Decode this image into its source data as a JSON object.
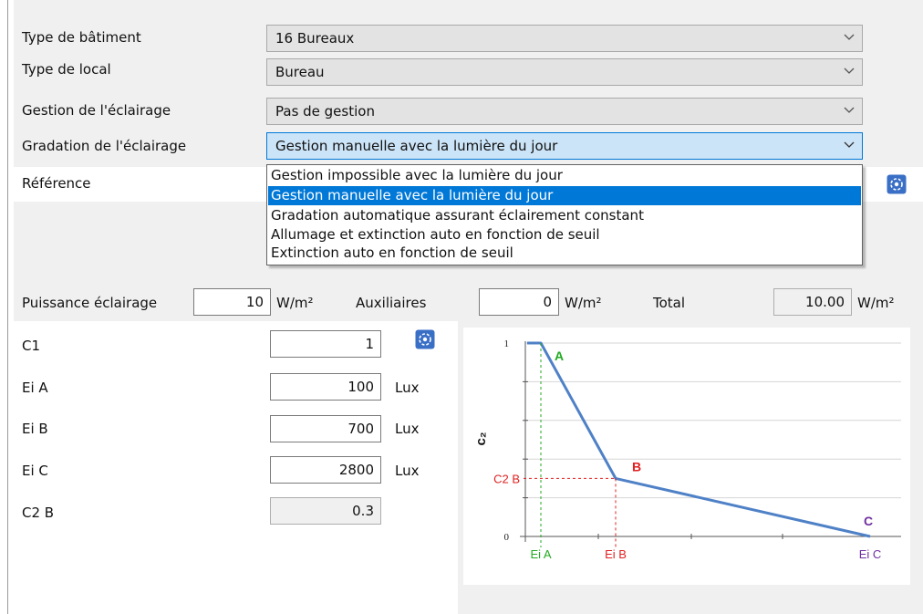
{
  "fields": [
    {
      "label": "Type de bâtiment",
      "value": "16 Bureaux"
    },
    {
      "label": "Type de local",
      "value": "Bureau"
    },
    {
      "label": "Gestion de l'éclairage",
      "value": "Pas de gestion"
    },
    {
      "label": "Gradation de l'éclairage",
      "value": "Gestion manuelle avec la lumière du jour"
    }
  ],
  "reference": {
    "label": "Référence"
  },
  "dropdown_options": [
    "Gestion impossible avec la lumière du jour",
    "Gestion manuelle avec la lumière du jour",
    "Gradation automatique assurant éclairement constant",
    "Allumage et extinction auto en fonction de seuil",
    "Extinction auto en fonction de seuil"
  ],
  "dropdown_selected_index": 1,
  "power": {
    "puissance_label": "Puissance éclairage",
    "puissance_value": "10",
    "puissance_unit": "W/m²",
    "auxiliaires_label": "Auxiliaires",
    "auxiliaires_value": "0",
    "auxiliaires_unit": "W/m²",
    "total_label": "Total",
    "total_value": "10.00",
    "total_unit": "W/m²"
  },
  "params": [
    {
      "label": "C1",
      "value": "1",
      "unit": ""
    },
    {
      "label": "Ei A",
      "value": "100",
      "unit": "Lux"
    },
    {
      "label": "Ei B",
      "value": "700",
      "unit": "Lux"
    },
    {
      "label": "Ei C",
      "value": "2800",
      "unit": "Lux"
    },
    {
      "label": "C2 B",
      "value": "0.3",
      "unit": ""
    }
  ],
  "colors": {
    "line": "#4f81c7",
    "green": "#22aa22",
    "red": "#e02020",
    "purple": "#7030a0",
    "selection": "#0078d7"
  },
  "chart_data": {
    "type": "line",
    "ylabel": "c₂",
    "ytick_labels": [
      "1",
      "0"
    ],
    "points": [
      {
        "label": "A",
        "x": "Ei A",
        "y": 1
      },
      {
        "label": "B",
        "x": "Ei B",
        "y": 0.3
      },
      {
        "label": "C",
        "x": "Ei C",
        "y": 0
      }
    ],
    "start_y": 1,
    "xtick_labels": [
      "Ei A",
      "Ei B",
      "Ei C"
    ],
    "yref_label": "C2 B",
    "ylim": [
      0,
      1
    ],
    "grid": true
  }
}
